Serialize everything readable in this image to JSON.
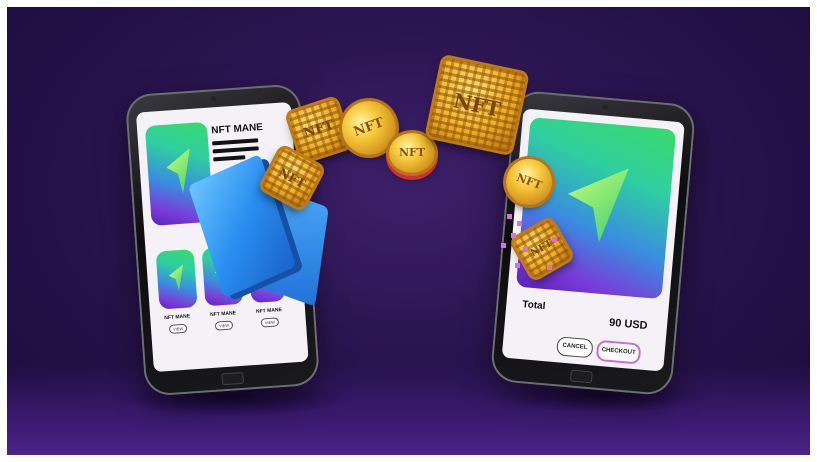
{
  "left_phone": {
    "title": "NFT MANE",
    "cards": [
      {
        "label": "NFT MANE",
        "button": "VIEW"
      },
      {
        "label": "NFT MANE",
        "button": "VIEW"
      },
      {
        "label": "NFT MANE",
        "button": "VIEW"
      }
    ]
  },
  "right_phone": {
    "total_label": "Total",
    "total_value": "90 USD",
    "cancel_label": "CANCEL",
    "checkout_label": "CHECKOUT"
  },
  "tokens": {
    "coin_text": "NFT",
    "tile_text": "NFT"
  },
  "colors": {
    "background": "#2a1450",
    "accent_checkout": "#c96bdc",
    "gold": "#f5c83a",
    "book_blue": "#2b8ef0"
  }
}
